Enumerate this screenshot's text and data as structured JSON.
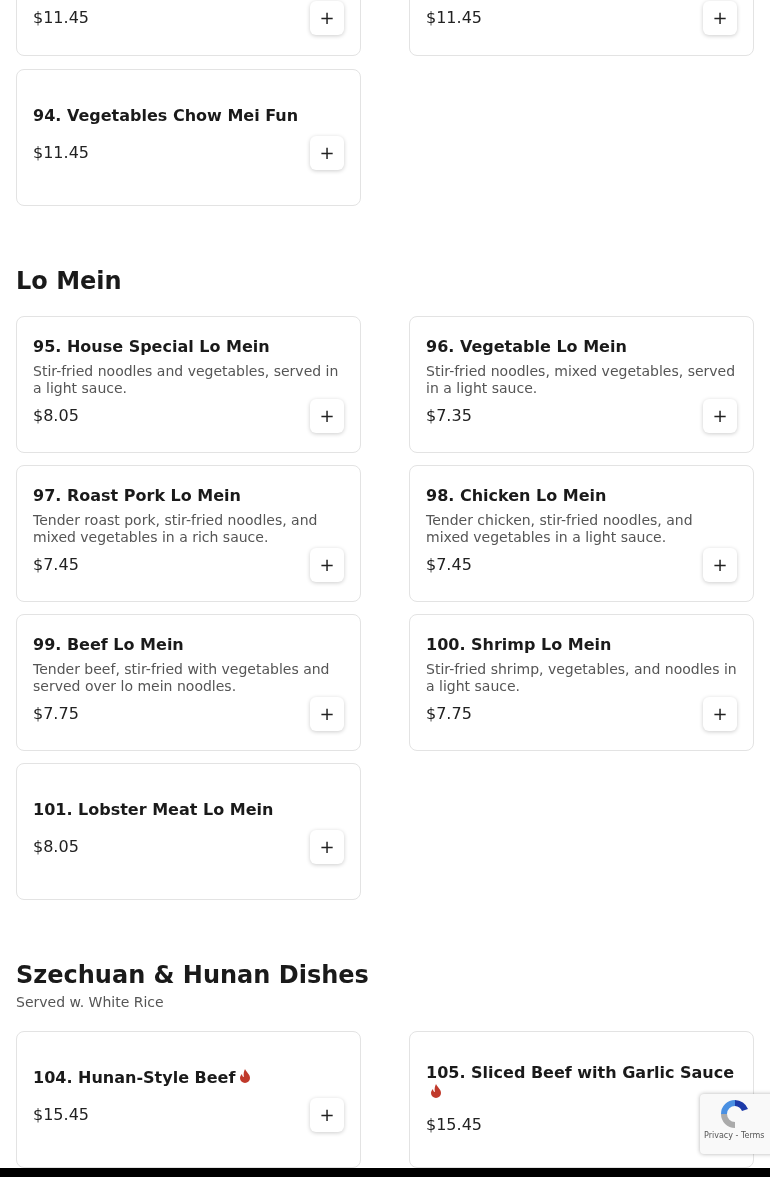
{
  "top_items": [
    {
      "price": "$11.45",
      "add_label": "+"
    },
    {
      "price": "$11.45",
      "add_label": "+"
    }
  ],
  "sections": [
    {
      "items": [
        {
          "name": "94. Vegetables Chow Mei Fun",
          "price": "$11.45",
          "spicy": false,
          "add_label": "+"
        }
      ]
    },
    {
      "title": "Lo Mein",
      "items": [
        {
          "name": "95. House Special Lo Mein",
          "description": "Stir-fried noodles and vegetables, served in a light sauce.",
          "price": "$8.05",
          "spicy": false,
          "add_label": "+"
        },
        {
          "name": "96. Vegetable Lo Mein",
          "description": "Stir-fried noodles, mixed vegetables, served in a light sauce.",
          "price": "$7.35",
          "spicy": false,
          "add_label": "+"
        },
        {
          "name": "97. Roast Pork Lo Mein",
          "description": "Tender roast pork, stir-fried noodles, and mixed vegetables in a rich sauce.",
          "price": "$7.45",
          "spicy": false,
          "add_label": "+"
        },
        {
          "name": "98. Chicken Lo Mein",
          "description": "Tender chicken, stir-fried noodles, and mixed vegetables in a light sauce.",
          "price": "$7.45",
          "spicy": false,
          "add_label": "+"
        },
        {
          "name": "99. Beef Lo Mein",
          "description": "Tender beef, stir-fried with vegetables and served over lo mein noodles.",
          "price": "$7.75",
          "spicy": false,
          "add_label": "+"
        },
        {
          "name": "100. Shrimp Lo Mein",
          "description": "Stir-fried shrimp, vegetables, and noodles in a light sauce.",
          "price": "$7.75",
          "spicy": false,
          "add_label": "+"
        },
        {
          "name": "101. Lobster Meat Lo Mein",
          "price": "$8.05",
          "spicy": false,
          "add_label": "+"
        }
      ]
    },
    {
      "title": "Szechuan & Hunan Dishes",
      "subtitle": "Served w. White Rice",
      "items": [
        {
          "name": "104. Hunan-Style Beef",
          "price": "$15.45",
          "spicy": true,
          "add_label": "+"
        },
        {
          "name": "105. Sliced Beef with Garlic Sauce",
          "price": "$15.45",
          "spicy": true
        }
      ]
    }
  ],
  "recaptcha": {
    "links": "Privacy - Terms"
  }
}
